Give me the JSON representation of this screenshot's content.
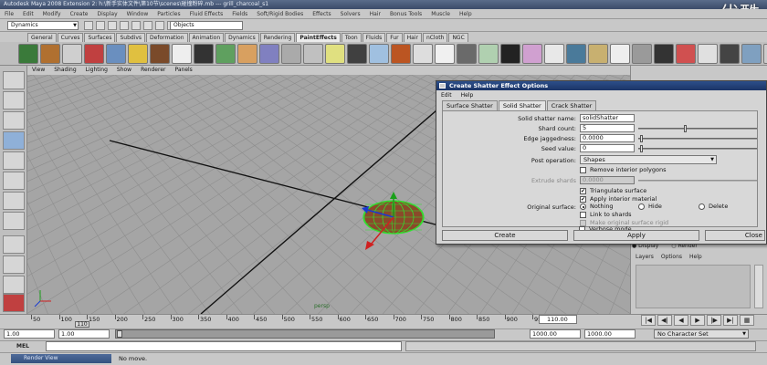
{
  "window": {
    "title": "Autodesk Maya 2008 Extension 2: h:\\新手实体文件\\第10节\\scenes\\碰撞粉碎.mb --- grill_charcoal_s1",
    "watermark": "优酷"
  },
  "menubar": [
    "File",
    "Edit",
    "Modify",
    "Create",
    "Display",
    "Window",
    "Particles",
    "Fluid Effects",
    "Fields",
    "Soft/Rigid Bodies",
    "Effects",
    "Solvers",
    "Hair",
    "Bonus Tools",
    "Muscle",
    "Help"
  ],
  "statusline": {
    "mode": "Dynamics",
    "objects_field": "Objects"
  },
  "shelf_tabs": [
    {
      "label": "General",
      "active": false
    },
    {
      "label": "Curves",
      "active": false
    },
    {
      "label": "Surfaces",
      "active": false
    },
    {
      "label": "Subdivs",
      "active": false
    },
    {
      "label": "Deformation",
      "active": false
    },
    {
      "label": "Animation",
      "active": false
    },
    {
      "label": "Dynamics",
      "active": false
    },
    {
      "label": "Rendering",
      "active": false
    },
    {
      "label": "PaintEffects",
      "active": true
    },
    {
      "label": "Toon",
      "active": false
    },
    {
      "label": "Fluids",
      "active": false
    },
    {
      "label": "Fur",
      "active": false
    },
    {
      "label": "Hair",
      "active": false
    },
    {
      "label": "nCloth",
      "active": false
    },
    {
      "label": "NGC",
      "active": false
    }
  ],
  "panel_menu": [
    "View",
    "Shading",
    "Lighting",
    "Show",
    "Renderer",
    "Panels"
  ],
  "viewport": {
    "camera_label": "persp"
  },
  "dialog": {
    "title": "Create Shatter Effect Options",
    "menu": [
      "Edit",
      "Help"
    ],
    "tabs": [
      {
        "label": "Surface Shatter",
        "active": false
      },
      {
        "label": "Solid Shatter",
        "active": true
      },
      {
        "label": "Crack Shatter",
        "active": false
      }
    ],
    "fields": {
      "shatter_name_label": "Solid shatter name:",
      "shatter_name_value": "solidShatter",
      "shard_count_label": "Shard count:",
      "shard_count_value": "5",
      "edge_jag_label": "Edge jaggedness:",
      "edge_jag_value": "0.0000",
      "seed_label": "Seed value:",
      "seed_value": "0",
      "post_op_label": "Post operation:",
      "post_op_value": "Shapes",
      "remove_interior_label": "Remove interior polygons",
      "extrude_label": "Extrude shards",
      "extrude_value": "0.0000",
      "triangulate_label": "Triangulate surface",
      "apply_material_label": "Apply interior material",
      "original_surface_label": "Original surface:",
      "radio_nothing": "Nothing",
      "radio_hide": "Hide",
      "radio_delete": "Delete",
      "link_label": "Link to shards",
      "make_rigid_label": "Make original surface rigid",
      "verbose_label": "Verbose mode"
    },
    "buttons": {
      "create": "Create",
      "apply": "Apply",
      "close": "Close"
    }
  },
  "right_panel": {
    "display_label": "Display",
    "render_label": "Render",
    "layers_menu": [
      "Layers",
      "Options",
      "Help"
    ]
  },
  "timeslider": {
    "ticks": [
      "50",
      "100",
      "150",
      "200",
      "250",
      "300",
      "350",
      "400",
      "450",
      "500",
      "550",
      "600",
      "650",
      "700",
      "750",
      "800",
      "850",
      "900",
      "950"
    ],
    "current_frame_marker": "110",
    "current_frame_field": "110.00"
  },
  "range": {
    "start": "1.00",
    "start2": "1.00",
    "end": "1000.00",
    "end2": "1000.00",
    "character_set": "No Character Set"
  },
  "command": {
    "label": "MEL"
  },
  "helpline": {
    "render_view": "Render View",
    "text": "No move."
  }
}
